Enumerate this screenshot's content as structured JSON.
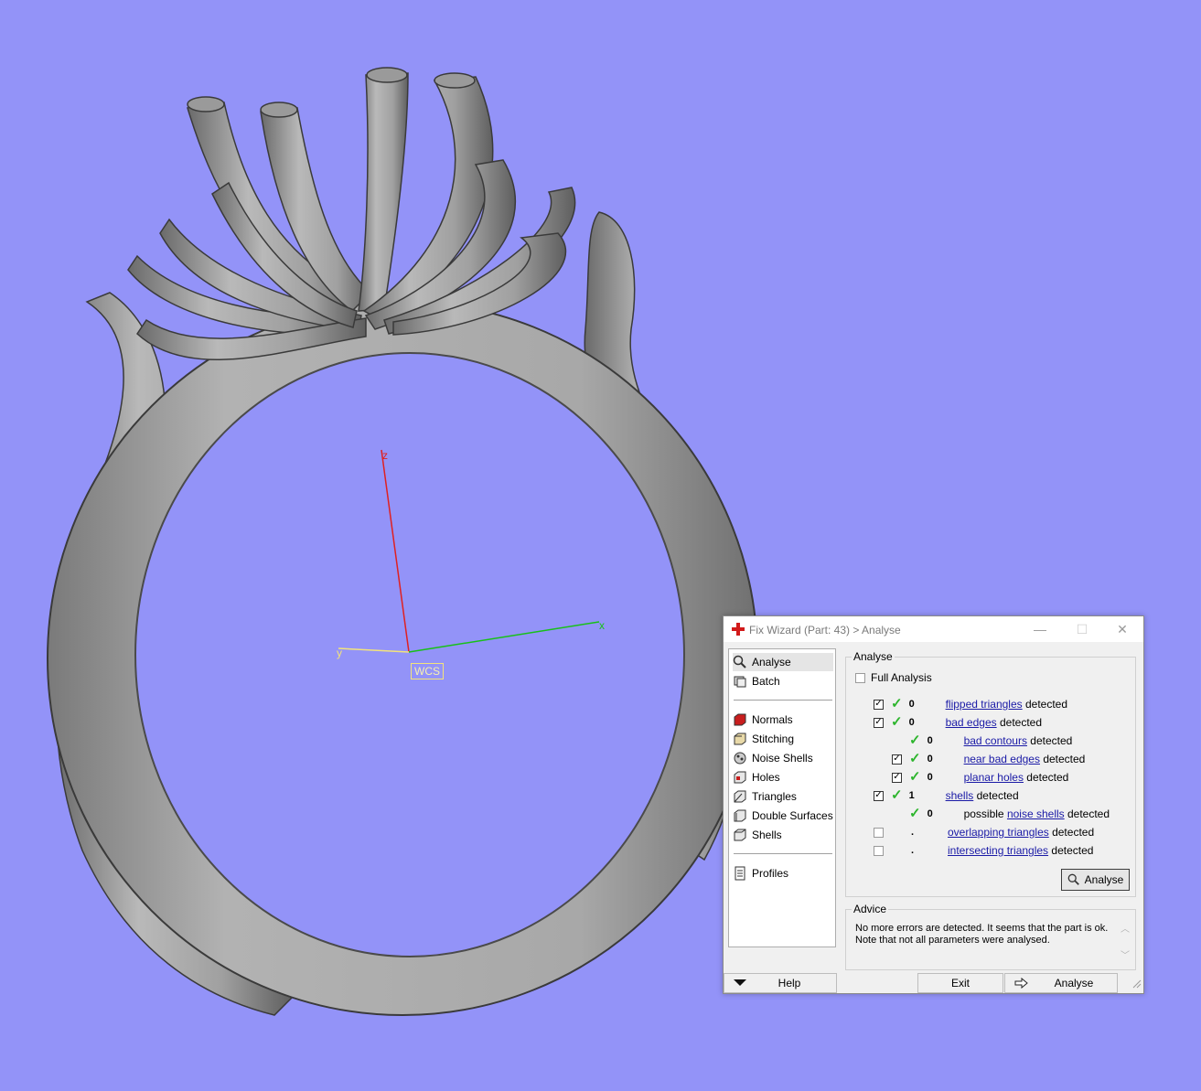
{
  "viewport": {
    "axes": {
      "z": "z",
      "y": "y",
      "x": "x",
      "origin": "WCS"
    },
    "colors": {
      "background": "#9393f8",
      "model": "#a9a9a9",
      "z_axis": "#e02020",
      "x_axis": "#18c018",
      "y_axis": "#f3e37b"
    }
  },
  "dialog": {
    "title": "Fix Wizard (Part: 43) > Analyse",
    "window_buttons": {
      "minimize": "—",
      "maximize": "☐",
      "close": "✕"
    },
    "nav": {
      "analyse": "Analyse",
      "batch": "Batch",
      "normals": "Normals",
      "stitching": "Stitching",
      "noise_shells": "Noise Shells",
      "holes": "Holes",
      "triangles": "Triangles",
      "double_surfaces": "Double Surfaces",
      "shells": "Shells",
      "profiles": "Profiles"
    },
    "analyse_group": {
      "label": "Analyse",
      "full_analysis": "Full Analysis",
      "rows": [
        {
          "checked": true,
          "count": "0",
          "link": "flipped triangles",
          "suffix": " detected"
        },
        {
          "checked": true,
          "count": "0",
          "link": "bad edges",
          "suffix": " detected"
        },
        {
          "checked": null,
          "count": "0",
          "link": "bad contours",
          "suffix": " detected"
        },
        {
          "checked": true,
          "count": "0",
          "link": "near bad edges",
          "suffix": " detected"
        },
        {
          "checked": true,
          "count": "0",
          "link": "planar holes",
          "suffix": " detected"
        },
        {
          "checked": true,
          "count": "1",
          "link": "shells",
          "suffix": " detected"
        },
        {
          "checked": null,
          "count": "0",
          "prefix": "possible ",
          "link": "noise shells",
          "suffix": " detected"
        },
        {
          "checked": false,
          "count": ".",
          "link": "overlapping triangles",
          "suffix": " detected"
        },
        {
          "checked": false,
          "count": ".",
          "link": "intersecting triangles",
          "suffix": " detected"
        }
      ],
      "analyse_button": "Analyse"
    },
    "advice": {
      "label": "Advice",
      "text": "No more errors are detected. It seems that the part is ok. Note that not all parameters were analysed."
    },
    "bottom": {
      "help": "Help",
      "exit": "Exit",
      "analyse": "Analyse"
    }
  }
}
